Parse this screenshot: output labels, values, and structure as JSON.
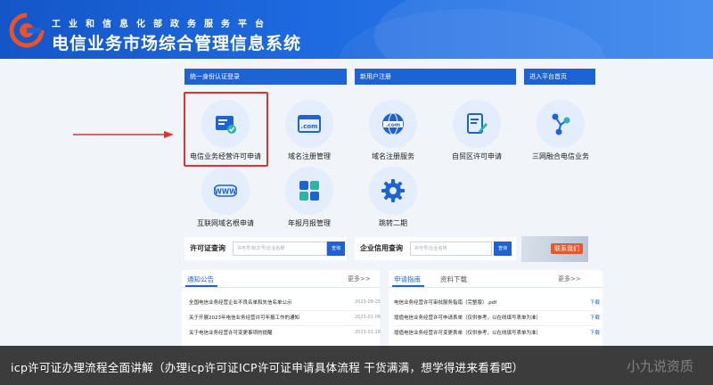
{
  "header": {
    "ministry": "工业和信息化部政务服务平台",
    "system_title": "电信业务市场综合管理信息系统"
  },
  "sections": {
    "unified_login": "统一身份认证登录",
    "new_user": "新用户注册",
    "enter_platform": "进入平台首页"
  },
  "services": [
    {
      "label": "电信业务经营许可申请",
      "icon": "license-card-icon"
    },
    {
      "label": "域名注册管理",
      "icon": "dotcom-icon"
    },
    {
      "label": "域名注册服务",
      "icon": "globe-com-icon"
    },
    {
      "label": "自贸区许可申请",
      "icon": "document-edit-icon"
    },
    {
      "label": "三网融合电信业务",
      "icon": "network-nodes-icon"
    },
    {
      "label": "互联网域名根申请",
      "icon": "www-icon"
    },
    {
      "label": "年报月报管理",
      "icon": "grid-tiles-icon"
    },
    {
      "label": "跳转二期",
      "icon": "gear-icon"
    }
  ],
  "license_query": {
    "label": "许可证查询",
    "placeholder": "许可号/批文号/企业名称",
    "button": "查询"
  },
  "credit_query": {
    "label": "企业信用查询",
    "placeholder": "许可号/企业名称",
    "button": "查询"
  },
  "contact_banner": "联系我们",
  "notice": {
    "tab": "通知公告",
    "more": "更多>>",
    "items": [
      {
        "title": "全国电信业务经营企业不良名单和失信名单公示",
        "date": "2023-08-25"
      },
      {
        "title": "关于开展2023年电信业务经营许可年报工作的通知",
        "date": "2023-01-06"
      },
      {
        "title": "关于电信业务经营许可变更事项的提醒",
        "date": "2023-01-18"
      }
    ]
  },
  "downloads": {
    "tab_guide": "申请指南",
    "tab_download": "资料下载",
    "more": "更多>>",
    "items": [
      {
        "title": "电信业务经营许可审批服务指南（完整版）.pdf",
        "link": "下载"
      },
      {
        "title": "增值电信业务经营许可申请表单（仅供参考，以在线填写表单为准）",
        "link": "下载"
      },
      {
        "title": "增值电信业务经营许可变更表单（仅供参考，以在线填写表单为准）",
        "link": "下载"
      }
    ]
  },
  "caption": "icp许可证办理流程全面讲解（办理icp许可证ICP许可证申请具体流程  干货满满，想学得进来看看吧）",
  "watermark": "小九说资质",
  "colors": {
    "brand_blue": "#1e63d6",
    "highlight_red": "#e0332e",
    "icon_bg": "#e3edfb"
  }
}
